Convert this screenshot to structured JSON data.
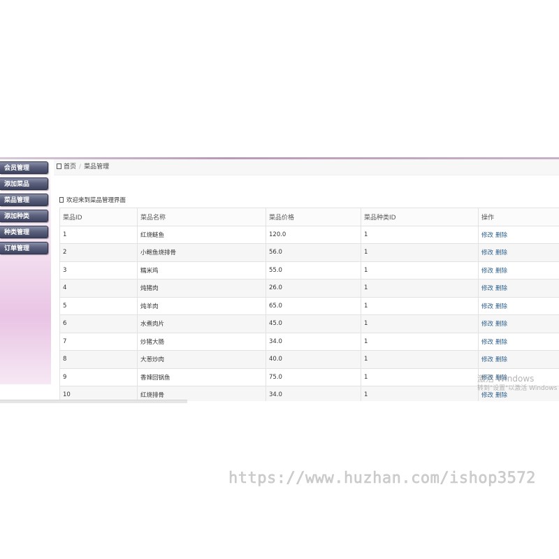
{
  "sidebar": {
    "items": [
      {
        "label": "会员管理"
      },
      {
        "label": "添加菜品"
      },
      {
        "label": "菜品管理"
      },
      {
        "label": "添加种类"
      },
      {
        "label": "种类管理"
      },
      {
        "label": "订单管理"
      }
    ]
  },
  "breadcrumb": {
    "home": "首页",
    "current": "菜品管理"
  },
  "welcome": "欢迎来到菜品管理界面",
  "table": {
    "headers": [
      "菜品ID",
      "菜品名称",
      "菜品价格",
      "菜品种类ID",
      "操作"
    ],
    "edit_label": "修改",
    "delete_label": "删除",
    "rows": [
      {
        "id": "1",
        "name": "红烧鲢鱼",
        "price": "120.0",
        "category": "1"
      },
      {
        "id": "2",
        "name": "小鲍鱼烧排骨",
        "price": "56.0",
        "category": "1"
      },
      {
        "id": "3",
        "name": "糯米鸡",
        "price": "55.0",
        "category": "1"
      },
      {
        "id": "4",
        "name": "炖猪肉",
        "price": "26.0",
        "category": "1"
      },
      {
        "id": "5",
        "name": "炖羊肉",
        "price": "65.0",
        "category": "1"
      },
      {
        "id": "6",
        "name": "水煮肉片",
        "price": "45.0",
        "category": "1"
      },
      {
        "id": "7",
        "name": "炒猪大肠",
        "price": "34.0",
        "category": "1"
      },
      {
        "id": "8",
        "name": "大葱炒肉",
        "price": "40.0",
        "category": "1"
      },
      {
        "id": "9",
        "name": "香辣回锅鱼",
        "price": "75.0",
        "category": "1"
      },
      {
        "id": "10",
        "name": "红烧排骨",
        "price": "34.0",
        "category": "1"
      }
    ]
  },
  "activation": {
    "title": "激活 Windows",
    "subtitle": "转到\"设置\"以激活 Windows"
  },
  "watermark": "https://www.huzhan.com/ishop3572"
}
